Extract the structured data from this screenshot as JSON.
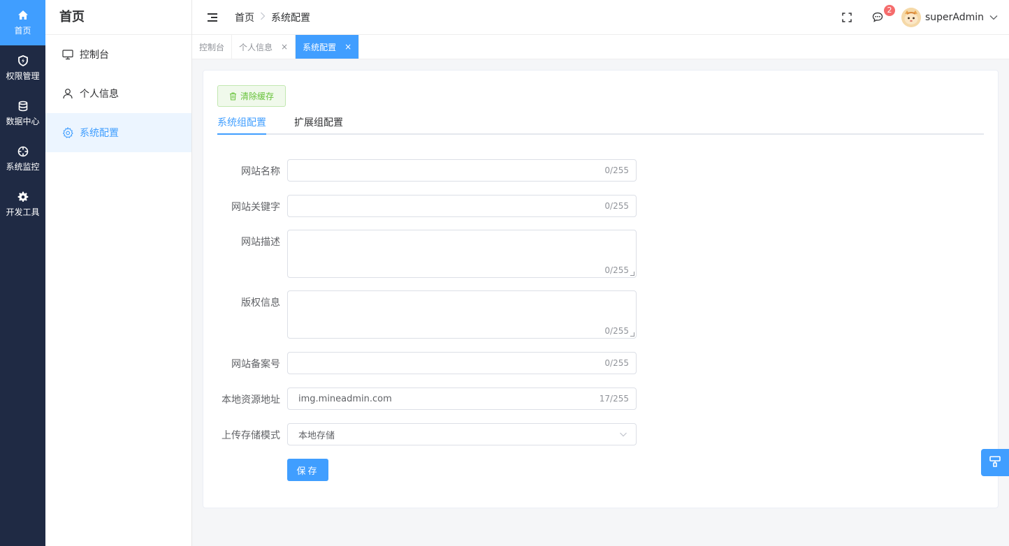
{
  "rail": {
    "items": [
      {
        "label": "首页",
        "icon": "home-icon"
      },
      {
        "label": "权限管理",
        "icon": "shield-icon"
      },
      {
        "label": "数据中心",
        "icon": "database-icon"
      },
      {
        "label": "系统监控",
        "icon": "target-icon"
      },
      {
        "label": "开发工具",
        "icon": "gear-icon"
      }
    ]
  },
  "sidebar": {
    "title": "首页",
    "items": [
      {
        "label": "控制台",
        "icon": "monitor-icon"
      },
      {
        "label": "个人信息",
        "icon": "user-icon"
      },
      {
        "label": "系统配置",
        "icon": "settings-icon"
      }
    ]
  },
  "header": {
    "breadcrumb": [
      "首页",
      "系统配置"
    ],
    "notification_count": "2",
    "username": "superAdmin"
  },
  "tags": {
    "items": [
      {
        "label": "控制台"
      },
      {
        "label": "个人信息",
        "close": "×"
      },
      {
        "label": "系统配置",
        "close": "×"
      }
    ]
  },
  "main": {
    "clear_cache_label": "清除缓存",
    "tabs": [
      "系统组配置",
      "扩展组配置"
    ],
    "form": {
      "site_name": {
        "label": "网站名称",
        "value": "",
        "count": "0/255"
      },
      "site_keywords": {
        "label": "网站关键字",
        "value": "",
        "count": "0/255"
      },
      "site_desc": {
        "label": "网站描述",
        "value": "",
        "count": "0/255"
      },
      "copyright": {
        "label": "版权信息",
        "value": "",
        "count": "0/255"
      },
      "record_no": {
        "label": "网站备案号",
        "value": "",
        "count": "0/255"
      },
      "resource_url": {
        "label": "本地资源地址",
        "value": "img.mineadmin.com",
        "count": "17/255"
      },
      "upload_mode": {
        "label": "上传存储模式",
        "value": "本地存储"
      }
    },
    "save_label": "保存"
  },
  "colors": {
    "primary": "#409eff",
    "rail_bg": "#1f2a44",
    "success": "#67c23a",
    "danger": "#f56c6c"
  }
}
